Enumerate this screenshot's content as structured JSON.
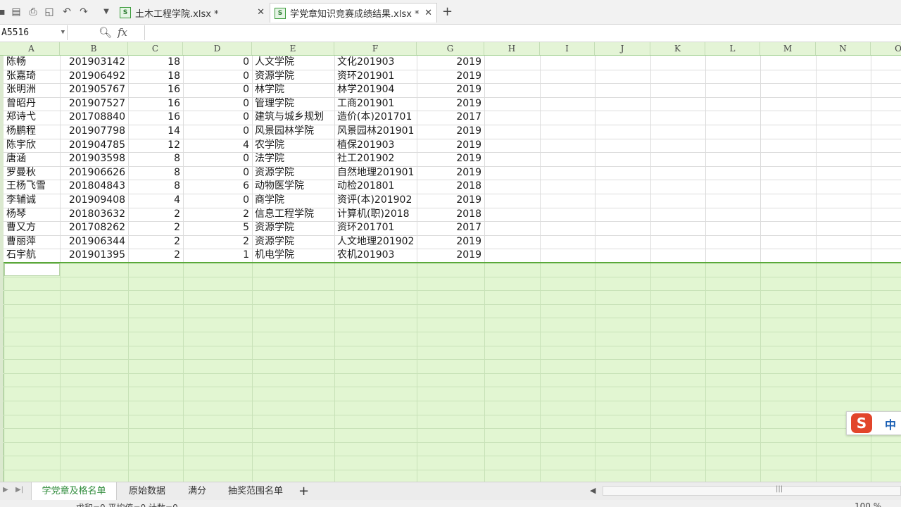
{
  "toolbar": {
    "icons": [
      "save-icon",
      "export-pdf-icon",
      "print-icon",
      "print-preview-icon",
      "undo-icon",
      "redo-icon",
      "dropdown-icon"
    ]
  },
  "doc_tabs": [
    {
      "label": "土木工程学院.xlsx *",
      "active": false
    },
    {
      "label": "学党章知识竞赛成绩结果.xlsx *",
      "active": true
    }
  ],
  "formula_bar": {
    "cell_ref": "A5516",
    "fx_label": "fx",
    "formula": ""
  },
  "columns": [
    "A",
    "B",
    "C",
    "D",
    "E",
    "F",
    "G",
    "H",
    "I",
    "J",
    "K",
    "L",
    "M",
    "N",
    "O"
  ],
  "rows": [
    [
      "陈畅",
      "201903142",
      "18",
      "0",
      "人文学院",
      "文化201903",
      "2019"
    ],
    [
      "张嘉琦",
      "201906492",
      "18",
      "0",
      "资源学院",
      "资环201901",
      "2019"
    ],
    [
      "张明洲",
      "201905767",
      "16",
      "0",
      "林学院",
      "林学201904",
      "2019"
    ],
    [
      "曾昭丹",
      "201907527",
      "16",
      "0",
      "管理学院",
      "工商201901",
      "2019"
    ],
    [
      "郑诗弋",
      "201708840",
      "16",
      "0",
      "建筑与城乡规划",
      "造价(本)201701",
      "2017"
    ],
    [
      "杨鹏程",
      "201907798",
      "14",
      "0",
      "风景园林学院",
      "风景园林201901",
      "2019"
    ],
    [
      "陈宇欣",
      "201904785",
      "12",
      "4",
      "农学院",
      "植保201903",
      "2019"
    ],
    [
      "唐涵",
      "201903598",
      "8",
      "0",
      "法学院",
      "社工201902",
      "2019"
    ],
    [
      "罗曼秋",
      "201906626",
      "8",
      "0",
      "资源学院",
      "自然地理201901",
      "2019"
    ],
    [
      "王杨飞雪",
      "201804843",
      "8",
      "6",
      "动物医学院",
      "动检201801",
      "2018"
    ],
    [
      "李辅诚",
      "201909408",
      "4",
      "0",
      "商学院",
      "资评(本)201902",
      "2019"
    ],
    [
      "杨琴",
      "201803632",
      "2",
      "2",
      "信息工程学院",
      "计算机(职)2018",
      "2018"
    ],
    [
      "曹又方",
      "201708262",
      "2",
      "5",
      "资源学院",
      "资环201701",
      "2017"
    ],
    [
      "曹丽萍",
      "201906344",
      "2",
      "2",
      "资源学院",
      "人文地理201902",
      "2019"
    ],
    [
      "石宇航",
      "201901395",
      "2",
      "1",
      "机电学院",
      "农机201903",
      "2019"
    ]
  ],
  "ime": {
    "logo": "S",
    "mode": "中"
  },
  "sheet_tabs": [
    "学党章及格名单",
    "原始数据",
    "满分",
    "抽奖范围名单"
  ],
  "status": {
    "text": "求和=0  平均值=0  计数=0",
    "zoom": "100 %"
  },
  "colors": {
    "grid_fill": "#e2f6d2",
    "accent": "#2e8b3a",
    "selection": "#5aa83a"
  }
}
